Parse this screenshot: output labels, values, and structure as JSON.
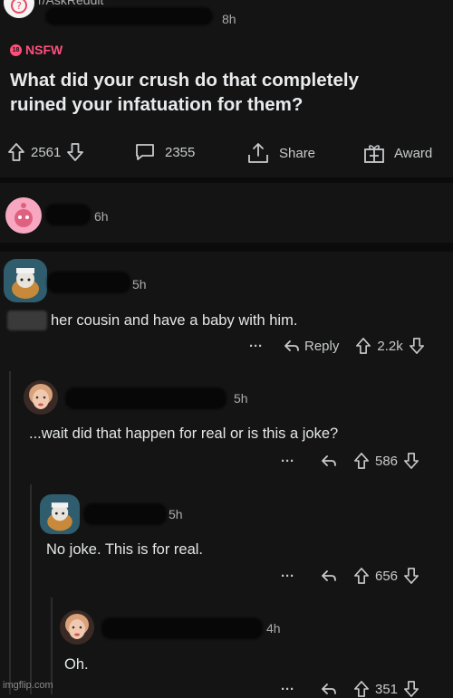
{
  "post": {
    "subreddit": "r/AskReddit",
    "time": "8h",
    "nsfw_label": "NSFW",
    "title_line1": "What did your crush do that completely",
    "title_line2": "ruined your infatuation for them?",
    "votes": "2561",
    "comments": "2355",
    "share_label": "Share",
    "award_label": "Award"
  },
  "comments": [
    {
      "time": "6h"
    },
    {
      "time": "5h",
      "text": "her cousin and have a baby with him.",
      "more": "···",
      "reply_label": "Reply",
      "votes": "2.2k"
    },
    {
      "time": "5h",
      "text": "...wait did that happen for real or is this a joke?",
      "more": "···",
      "votes": "586"
    },
    {
      "time": "5h",
      "text": "No joke. This is for real.",
      "more": "···",
      "votes": "656"
    },
    {
      "time": "4h",
      "text": "Oh.",
      "more": "···",
      "votes": "351"
    }
  ],
  "watermark": "imgflip.com",
  "colors": {
    "background": "#141414",
    "nsfw": "#ff4f7b",
    "text": "#d7dadc"
  }
}
